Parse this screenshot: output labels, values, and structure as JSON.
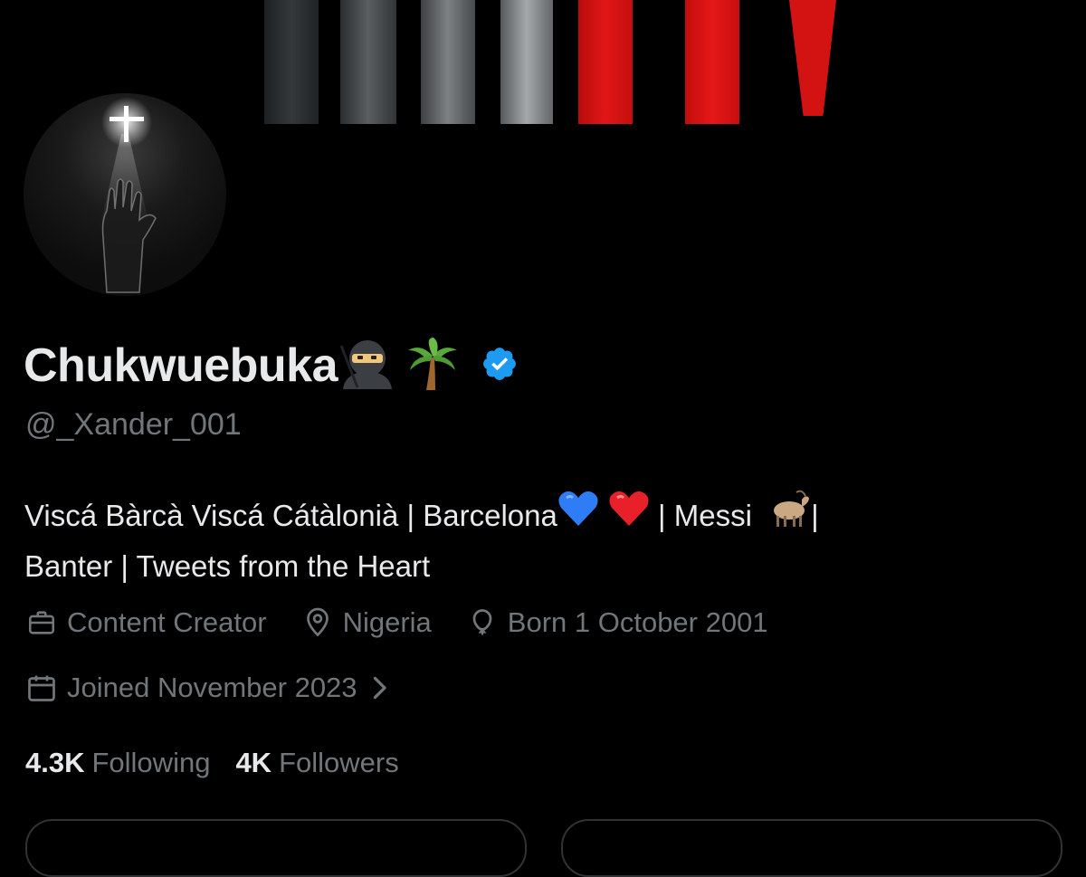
{
  "profile": {
    "name": "Chukwuebuka",
    "name_emojis": [
      "ninja-emoji",
      "palm-tree-emoji"
    ],
    "verified": true,
    "verified_color": "#1d9bf0",
    "handle": "@_Xander_001",
    "bio_line1_part1": "Viscá Bàrcà Viscá Cátàlonià | Barcelona",
    "bio_line1_part2": " | Messi ",
    "bio_line1_part3": "|",
    "bio_line2": "Banter | Tweets from the Heart",
    "bio_emojis": [
      "blue-heart-emoji",
      "red-heart-emoji",
      "goat-emoji"
    ]
  },
  "meta": {
    "category": "Content Creator",
    "location": "Nigeria",
    "birth": "Born 1 October 2001",
    "joined": "Joined November 2023"
  },
  "stats": {
    "following_count": "4.3K",
    "following_label": "Following",
    "followers_count": "4K",
    "followers_label": "Followers"
  },
  "colors": {
    "background": "#000000",
    "primary_text": "#e7e9ea",
    "secondary_text": "#71767b",
    "accent": "#1d9bf0"
  }
}
